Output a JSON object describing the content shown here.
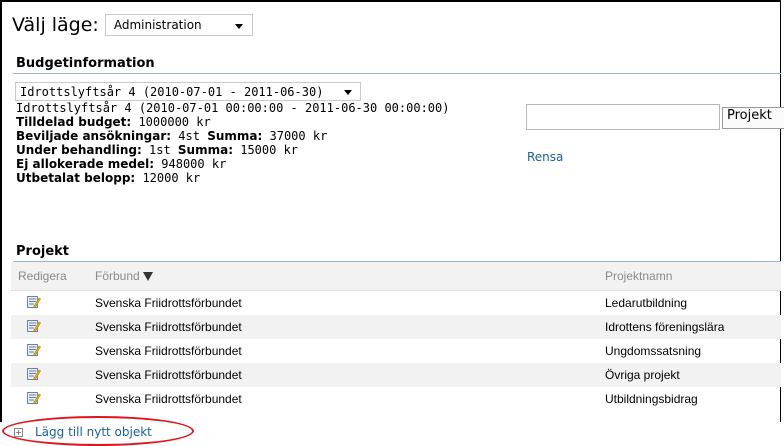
{
  "mode": {
    "label": "Välj läge:",
    "selected": "Administration"
  },
  "budget": {
    "title": "Budgetinformation",
    "period_selected": "Idrottslyftsår 4 (2010-07-01 - 2011-06-30)",
    "period_full": "Idrottslyftsår 4 (2010-07-01 00:00:00 - 2011-06-30 00:00:00)",
    "allocated_label": "Tilldelad budget:",
    "allocated_value": " 1000000 kr",
    "approved_label": "Beviljade ansökningar:",
    "approved_count": " 4st ",
    "sum_label": "Summa:",
    "approved_sum": " 37000 kr",
    "pending_label": "Under behandling:",
    "pending_count": " 1st ",
    "pending_sum": " 15000 kr",
    "unallocated_label": "Ej allokerade medel:",
    "unallocated_value": " 948000 kr",
    "paid_label": "Utbetalat belopp:",
    "paid_value": " 12000 kr"
  },
  "search": {
    "button_label": "Projekt",
    "clear_label": "Rensa"
  },
  "projects": {
    "title": "Projekt",
    "columns": {
      "edit": "Redigera",
      "org": "Förbund",
      "name": "Projektnamn"
    },
    "rows": [
      {
        "org": "Svenska Friidrottsförbundet",
        "name": "Ledarutbildning"
      },
      {
        "org": "Svenska Friidrottsförbundet",
        "name": "Idrottens föreningslära"
      },
      {
        "org": "Svenska Friidrottsförbundet",
        "name": "Ungdomssatsning"
      },
      {
        "org": "Svenska Friidrottsförbundet",
        "name": "Övriga projekt"
      },
      {
        "org": "Svenska Friidrottsförbundet",
        "name": "Utbildningsbidrag"
      }
    ],
    "add_label": "Lägg till nytt objekt"
  },
  "colors": {
    "link": "#1a5ea6",
    "highlight_oval": "#e2141b"
  },
  "icons": {
    "edit": "edit-icon",
    "filter": "filter-icon",
    "add": "add-icon"
  }
}
